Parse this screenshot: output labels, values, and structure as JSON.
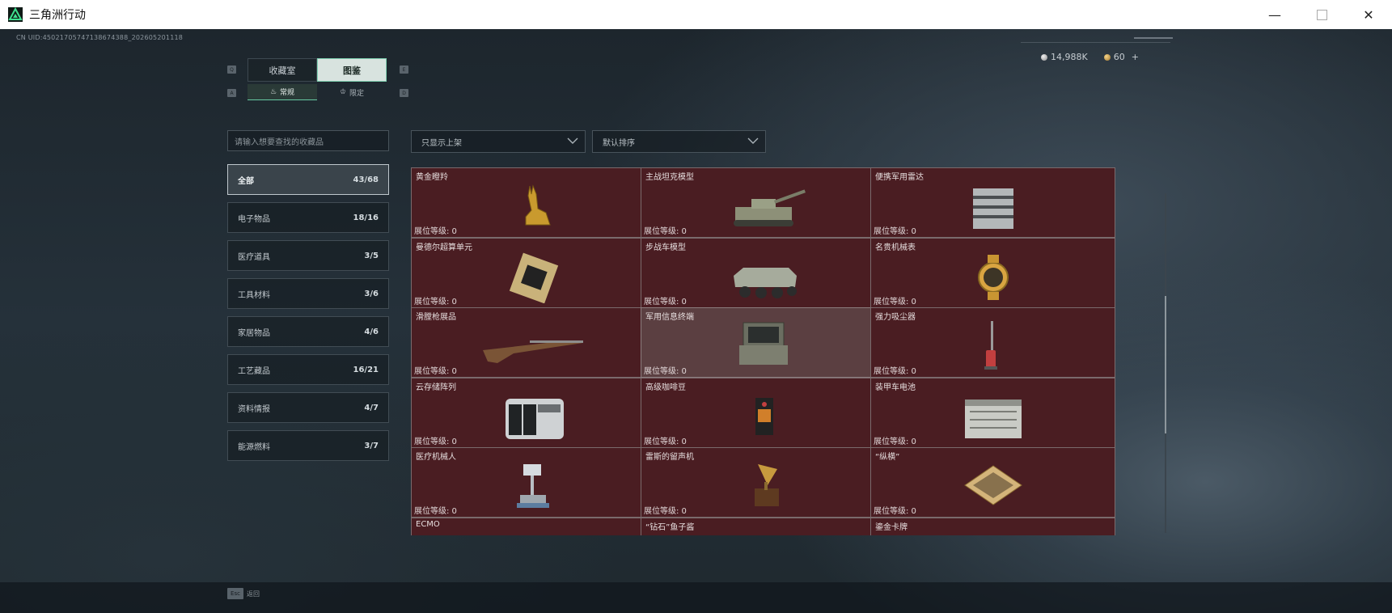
{
  "window": {
    "title": "三角洲行动",
    "minimize": "—",
    "close": "✕"
  },
  "hud": {
    "uid": "CN UID:450217057471386743​88_2026052011​18",
    "silver": "14,988K",
    "gold": "60",
    "add": "+"
  },
  "keys": {
    "q": "Q",
    "e": "E",
    "a": "A",
    "d": "D"
  },
  "tabs": [
    {
      "label": "收藏室",
      "active": false
    },
    {
      "label": "图鉴",
      "active": true
    }
  ],
  "subtabs": [
    {
      "label": "常规",
      "active": true
    },
    {
      "label": "限定",
      "active": false
    }
  ],
  "search": {
    "placeholder": "请输入想要查找的收藏品"
  },
  "filters": {
    "show": "只显示上架",
    "sort": "默认排序"
  },
  "categories": [
    {
      "label": "全部",
      "count": "43/68",
      "active": true
    },
    {
      "label": "电子物品",
      "count": "18/16",
      "active": false
    },
    {
      "label": "医疗道具",
      "count": "3/5",
      "active": false
    },
    {
      "label": "工具材料",
      "count": "3/6",
      "active": false
    },
    {
      "label": "家居物品",
      "count": "4/6",
      "active": false
    },
    {
      "label": "工艺藏品",
      "count": "16/21",
      "active": false
    },
    {
      "label": "资料情报",
      "count": "4/7",
      "active": false
    },
    {
      "label": "能源燃料",
      "count": "3/7",
      "active": false
    }
  ],
  "level_label": "展位等级:  0",
  "items": [
    {
      "name": "黄金瞪羚",
      "icon": "gazelle-icon"
    },
    {
      "name": "主战坦克模型",
      "icon": "tank-icon"
    },
    {
      "name": "便携军用雷达",
      "icon": "radar-icon"
    },
    {
      "name": "曼德尔超算单元",
      "icon": "supercomputer-icon"
    },
    {
      "name": "步战车模型",
      "icon": "ifv-icon"
    },
    {
      "name": "名贵机械表",
      "icon": "watch-icon"
    },
    {
      "name": "滑膛枪展品",
      "icon": "musket-icon"
    },
    {
      "name": "军用信息终端",
      "icon": "terminal-icon"
    },
    {
      "name": "强力吸尘器",
      "icon": "vacuum-icon"
    },
    {
      "name": "云存储阵列",
      "icon": "storage-array-icon"
    },
    {
      "name": "高级咖啡豆",
      "icon": "coffee-bag-icon"
    },
    {
      "name": "装甲车电池",
      "icon": "battery-icon"
    },
    {
      "name": "医疗机械人",
      "icon": "medical-robot-icon"
    },
    {
      "name": "雷斯的留声机",
      "icon": "gramophone-icon"
    },
    {
      "name": "“纵横”",
      "icon": "chessboard-icon"
    },
    {
      "name": "ECMO",
      "icon": "ecmo-icon"
    },
    {
      "name": "“钻石”鱼子酱",
      "icon": "caviar-icon"
    },
    {
      "name": "鎏金卡牌",
      "icon": "card-icon"
    }
  ],
  "footer": {
    "esc_key": "Esc",
    "esc_label": "返回"
  },
  "colors": {
    "accent": "#67c9a2",
    "card_bg": "#4a1d22",
    "card_highlight": "#5b3f41"
  }
}
